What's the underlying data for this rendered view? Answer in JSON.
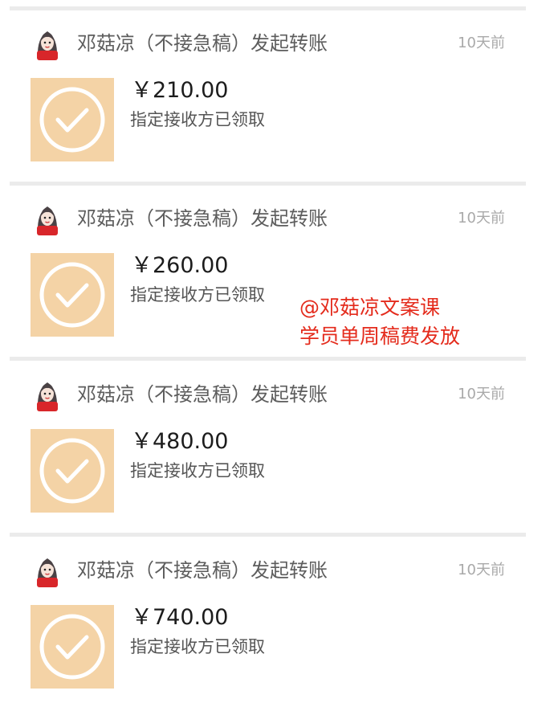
{
  "transfers": [
    {
      "sender": "邓菇凉（不接急稿）发起转账",
      "time": "10天前",
      "amount": "￥210.00",
      "status": "指定接收方已领取"
    },
    {
      "sender": "邓菇凉（不接急稿）发起转账",
      "time": "10天前",
      "amount": "￥260.00",
      "status": "指定接收方已领取"
    },
    {
      "sender": "邓菇凉（不接急稿）发起转账",
      "time": "10天前",
      "amount": "￥480.00",
      "status": "指定接收方已领取"
    },
    {
      "sender": "邓菇凉（不接急稿）发起转账",
      "time": "10天前",
      "amount": "￥740.00",
      "status": "指定接收方已领取"
    }
  ],
  "watermark": {
    "line1": "@邓菇凉文案课",
    "line2": "学员单周稿费发放"
  },
  "colors": {
    "transfer_icon_bg": "#f4d3a6",
    "watermark_red": "#e42b1c"
  }
}
